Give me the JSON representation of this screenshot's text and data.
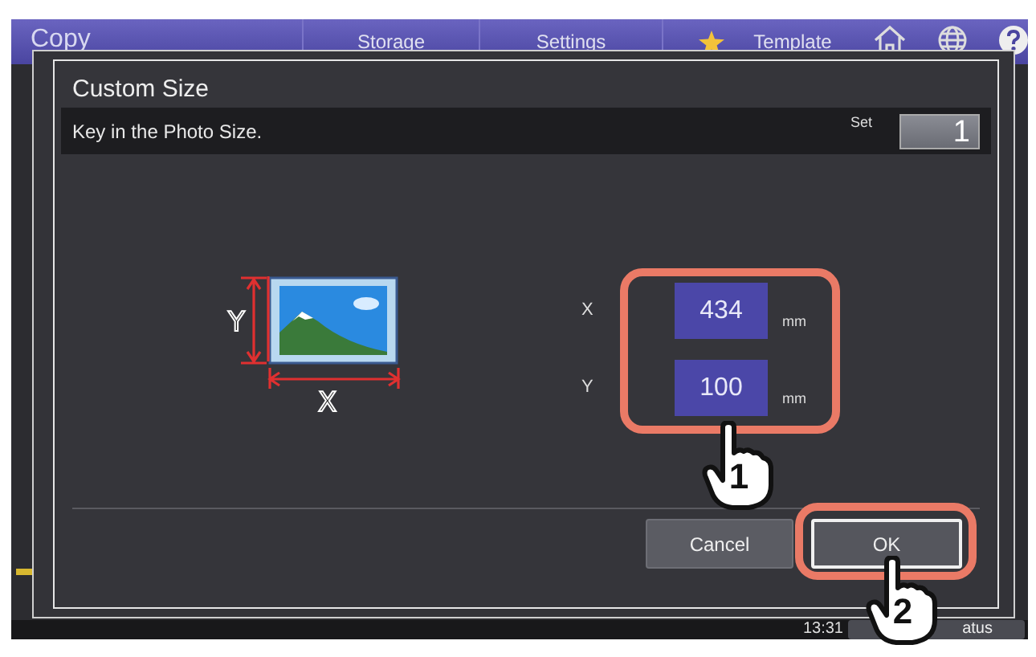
{
  "header": {
    "title": "Copy",
    "tabs": [
      {
        "label": "Storage",
        "starred": false
      },
      {
        "label": "Settings",
        "starred": false
      },
      {
        "label": "Template",
        "starred": true
      }
    ]
  },
  "dialog": {
    "title": "Custom Size",
    "message": "Key in the Photo Size.",
    "set_label": "Set",
    "set_value": "1",
    "diagram_labels": {
      "height": "Y",
      "width": "X"
    },
    "fields": [
      {
        "label": "X",
        "value": "434",
        "unit": "mm"
      },
      {
        "label": "Y",
        "value": "100",
        "unit": "mm"
      }
    ],
    "buttons": [
      {
        "label": "Cancel",
        "highlighted": false
      },
      {
        "label": "OK",
        "highlighted": true
      }
    ]
  },
  "status": {
    "time": "13:31",
    "button": "atus"
  },
  "callouts": [
    {
      "number": "1"
    },
    {
      "number": "2"
    }
  ]
}
